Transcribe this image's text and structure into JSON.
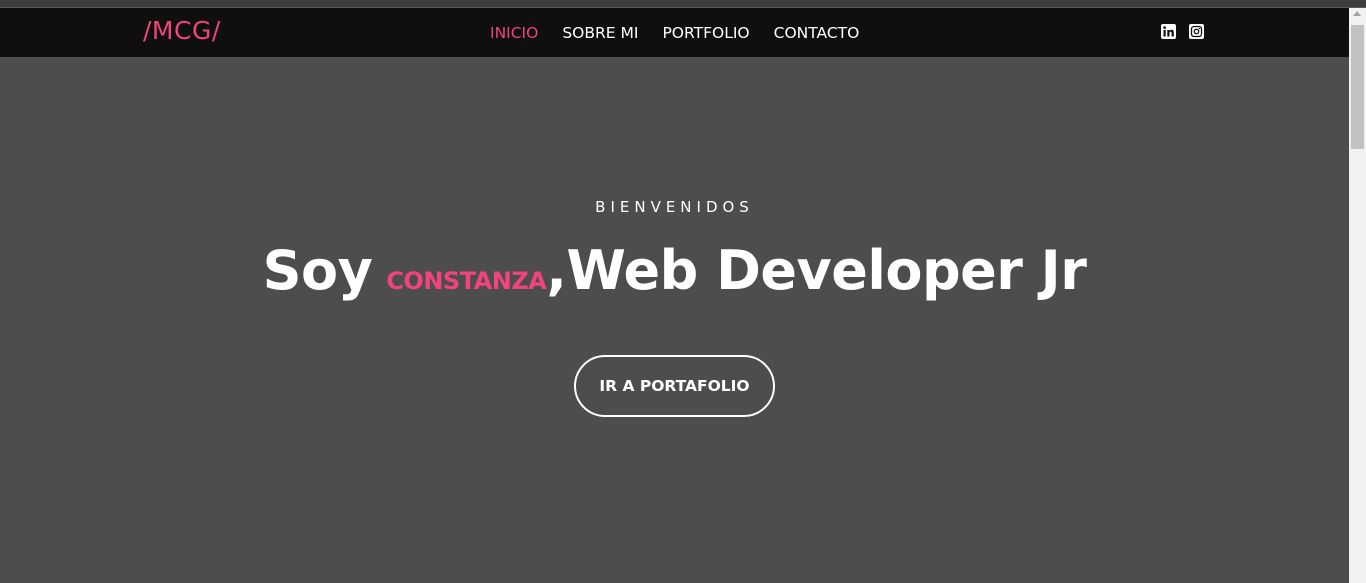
{
  "header": {
    "brand": "/MCG/",
    "nav": [
      {
        "label": "INICIO",
        "active": true
      },
      {
        "label": "SOBRE MI",
        "active": false
      },
      {
        "label": "PORTFOLIO",
        "active": false
      },
      {
        "label": "CONTACTO",
        "active": false
      }
    ],
    "socials": [
      {
        "icon": "linkedin-icon"
      },
      {
        "icon": "instagram-icon"
      }
    ]
  },
  "hero": {
    "welcome": "BIENVENIDOS",
    "headline_prefix": "Soy",
    "headline_name": "CONSTANZA",
    "headline_suffix": ",Web Developer Jr",
    "cta_label": "IR A PORTAFOLIO"
  },
  "colors": {
    "accent": "#f0447a",
    "navbar_bg": "#0f0f0f",
    "hero_bg": "#4d4d4d",
    "text": "#ffffff"
  }
}
